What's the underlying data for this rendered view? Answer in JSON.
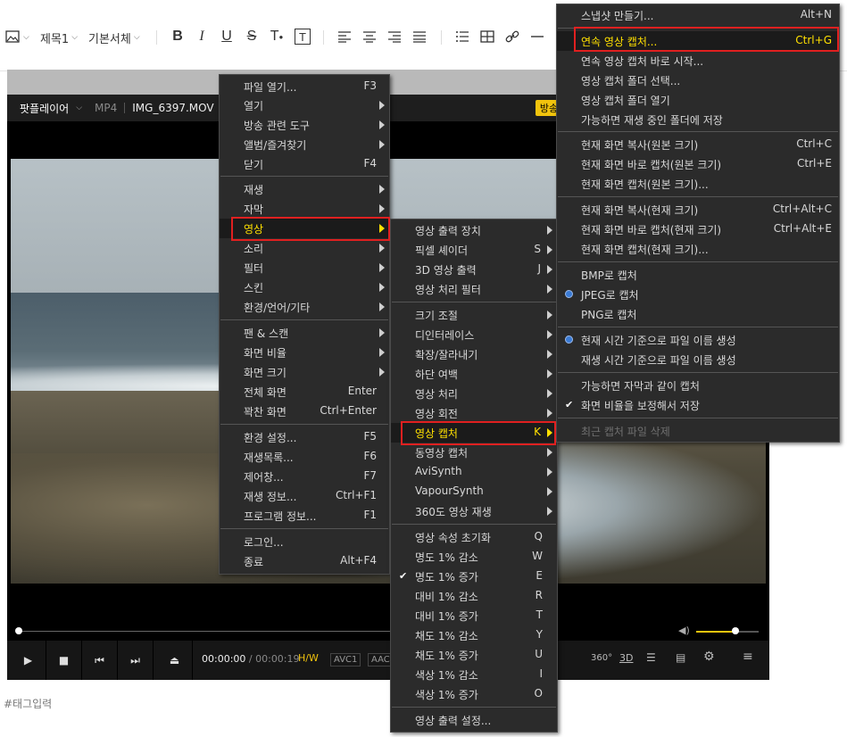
{
  "toolbar": {
    "paragraph_style": "제목1",
    "font": "기본서체"
  },
  "player": {
    "brand": "팟플레이어",
    "format": "MP4",
    "filename": "IMG_6397.MOV",
    "badge": "방송",
    "time_current": "00:00:00",
    "time_separator": " / ",
    "time_total": "00:00:19",
    "hw": "H/W",
    "codec1": "AVC1",
    "codec2": "AAC",
    "vol_level": 0.63
  },
  "tag_placeholder": "#태그입력",
  "main_menu": [
    {
      "label": "파일 열기...",
      "shortcut": "F3"
    },
    {
      "label": "열기",
      "arrow": true
    },
    {
      "label": "방송 관련 도구",
      "arrow": true
    },
    {
      "label": "앨범/즐겨찾기",
      "arrow": true
    },
    {
      "label": "닫기",
      "shortcut": "F4"
    },
    {
      "label": "재생",
      "arrow": true
    },
    {
      "label": "자막",
      "arrow": true
    },
    {
      "label": "영상",
      "arrow": true
    },
    {
      "label": "소리",
      "arrow": true
    },
    {
      "label": "필터",
      "arrow": true
    },
    {
      "label": "스킨",
      "arrow": true
    },
    {
      "label": "환경/언어/기타",
      "arrow": true
    },
    {
      "label": "팬 & 스캔",
      "arrow": true
    },
    {
      "label": "화면 비율",
      "arrow": true
    },
    {
      "label": "화면 크기",
      "arrow": true
    },
    {
      "label": "전체 화면",
      "shortcut": "Enter"
    },
    {
      "label": "꽉찬 화면",
      "shortcut": "Ctrl+Enter"
    },
    {
      "label": "환경 설정...",
      "shortcut": "F5"
    },
    {
      "label": "재생목록...",
      "shortcut": "F6"
    },
    {
      "label": "제어창...",
      "shortcut": "F7"
    },
    {
      "label": "재생 정보...",
      "shortcut": "Ctrl+F1"
    },
    {
      "label": "프로그램 정보...",
      "shortcut": "F1"
    },
    {
      "label": "로그인..."
    },
    {
      "label": "종료",
      "shortcut": "Alt+F4"
    }
  ],
  "video_menu": [
    {
      "label": "영상 출력 장치",
      "arrow": true
    },
    {
      "label": "픽셀 셰이더",
      "shortcut": "S",
      "arrow": true
    },
    {
      "label": "3D 영상 출력",
      "shortcut": "J",
      "arrow": true
    },
    {
      "label": "영상 처리 필터",
      "arrow": true
    },
    {
      "label": "크기 조절",
      "arrow": true
    },
    {
      "label": "디인터레이스",
      "arrow": true
    },
    {
      "label": "확장/잘라내기",
      "arrow": true
    },
    {
      "label": "하단 여백",
      "arrow": true
    },
    {
      "label": "영상 처리",
      "arrow": true
    },
    {
      "label": "영상 회전",
      "arrow": true
    },
    {
      "label": "영상 캡처",
      "shortcut": "K",
      "arrow": true
    },
    {
      "label": "동영상 캡처",
      "arrow": true
    },
    {
      "label": "AviSynth",
      "arrow": true
    },
    {
      "label": "VapourSynth",
      "arrow": true
    },
    {
      "label": "360도 영상 재생",
      "arrow": true
    },
    {
      "label": "영상 속성 초기화",
      "shortcut": "Q"
    },
    {
      "label": "명도 1% 감소",
      "shortcut": "W"
    },
    {
      "label": "명도 1% 증가",
      "shortcut": "E",
      "checked": true
    },
    {
      "label": "대비 1% 감소",
      "shortcut": "R"
    },
    {
      "label": "대비 1% 증가",
      "shortcut": "T"
    },
    {
      "label": "채도 1% 감소",
      "shortcut": "Y"
    },
    {
      "label": "채도 1% 증가",
      "shortcut": "U"
    },
    {
      "label": "색상 1% 감소",
      "shortcut": "I"
    },
    {
      "label": "색상 1% 증가",
      "shortcut": "O"
    },
    {
      "label": "영상 출력 설정..."
    }
  ],
  "capture_menu": [
    {
      "label": "스냅샷 만들기...",
      "shortcut": "Alt+N"
    },
    {
      "label": "연속 영상 캡처...",
      "shortcut": "Ctrl+G"
    },
    {
      "label": "연속 영상 캡처 바로 시작..."
    },
    {
      "label": "영상 캡처 폴더 선택..."
    },
    {
      "label": "영상 캡처 폴더 열기"
    },
    {
      "label": "가능하면 재생 중인 폴더에 저장"
    },
    {
      "label": "현재 화면 복사(원본 크기)",
      "shortcut": "Ctrl+C"
    },
    {
      "label": "현재 화면 바로 캡처(원본 크기)",
      "shortcut": "Ctrl+E"
    },
    {
      "label": "현재 화면 캡처(원본 크기)..."
    },
    {
      "label": "현재 화면 복사(현재 크기)",
      "shortcut": "Ctrl+Alt+C"
    },
    {
      "label": "현재 화면 바로 캡처(현재 크기)",
      "shortcut": "Ctrl+Alt+E"
    },
    {
      "label": "현재 화면 캡처(현재 크기)..."
    },
    {
      "label": "BMP로 캡처"
    },
    {
      "label": "JPEG로 캡처",
      "radio": true
    },
    {
      "label": "PNG로 캡처"
    },
    {
      "label": "현재 시간 기준으로 파일 이름 생성",
      "radio": true
    },
    {
      "label": "재생 시간 기준으로 파일 이름 생성"
    },
    {
      "label": "가능하면 자막과 같이 캡처"
    },
    {
      "label": "화면 비율을 보정해서 저장",
      "checked": true
    },
    {
      "label": "최근 캡처 파일 삭제",
      "disabled": true
    }
  ]
}
